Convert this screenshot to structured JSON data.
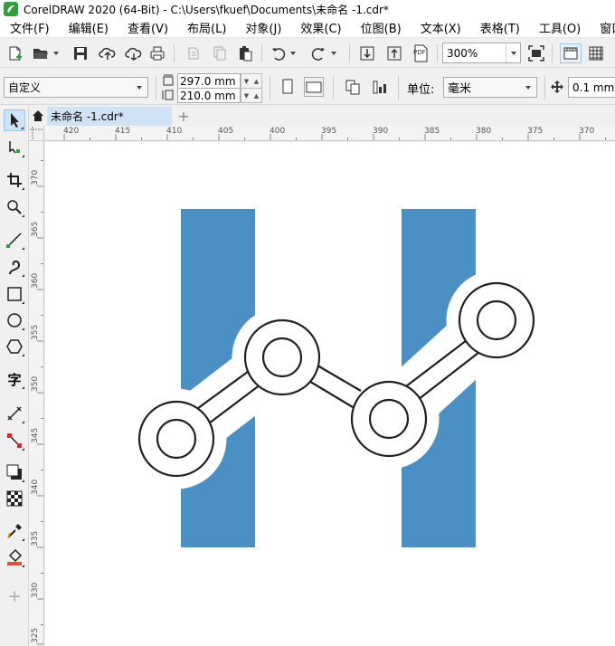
{
  "window": {
    "title": "CorelDRAW 2020 (64-Bit) - C:\\Users\\fkuef\\Documents\\未命名 -1.cdr*"
  },
  "menu": [
    {
      "label": "文件(F)",
      "name": "file"
    },
    {
      "label": "编辑(E)",
      "name": "edit"
    },
    {
      "label": "查看(V)",
      "name": "view"
    },
    {
      "label": "布局(L)",
      "name": "layout"
    },
    {
      "label": "对象(J)",
      "name": "object"
    },
    {
      "label": "效果(C)",
      "name": "effects"
    },
    {
      "label": "位图(B)",
      "name": "bitmaps"
    },
    {
      "label": "文本(X)",
      "name": "text"
    },
    {
      "label": "表格(T)",
      "name": "table"
    },
    {
      "label": "工具(O)",
      "name": "tools"
    },
    {
      "label": "窗口",
      "name": "window"
    }
  ],
  "toolbar": {
    "zoom_value": "300%",
    "pdf_label": "PDF"
  },
  "propbar": {
    "preset": "自定义",
    "width": "297.0 mm",
    "height": "210.0 mm",
    "units_label": "单位:",
    "units_value": "毫米",
    "nudge": "0.1 mm"
  },
  "tabs": {
    "document": "未命名 -1.cdr*",
    "add": "+"
  },
  "ruler": {
    "top": [
      "420",
      "415",
      "410",
      "405",
      "400",
      "395",
      "390",
      "385",
      "380",
      "375",
      "370"
    ],
    "left": [
      "370",
      "365",
      "360",
      "355",
      "350",
      "345",
      "340",
      "335",
      "330",
      "325"
    ]
  },
  "toolbox": {
    "text_tool_glyph": "字",
    "add_tool_glyph": "+"
  },
  "colors": {
    "accent": "#4a90c4",
    "tab_active": "#cfe3f5",
    "stroke": "#231f20"
  }
}
